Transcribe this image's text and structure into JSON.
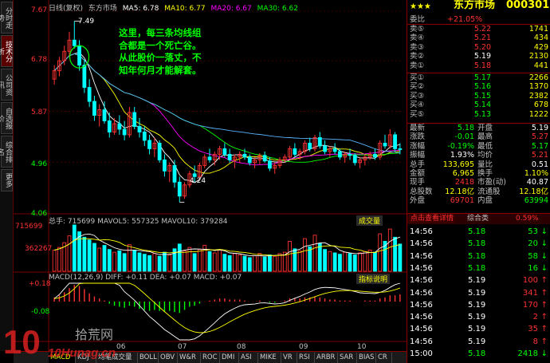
{
  "left_tabs": [
    "分时走势",
    "技术分析",
    "公司资讯",
    "自选报价",
    "综合排名",
    "更多"
  ],
  "header": {
    "period": "日线(复权)",
    "stock_name": "东方市场",
    "ma5": "MA5: 6.78",
    "ma10": "MA10: 6.77",
    "ma20": "MA20: 6.67",
    "ma30": "MA30: 6.62"
  },
  "price_axis": [
    "7.67",
    "6.78",
    "5.87",
    "4.96",
    "4.06"
  ],
  "annotations": {
    "high": "7.49",
    "low": "4.24",
    "comment_lines": [
      "这里，每三条均线组",
      "合都是一个死亡谷。",
      "从此股价一落丈，不",
      "知年何月才能解套。"
    ]
  },
  "volume": {
    "header": "总手: 715699 MAVOL5: 557325 MAVOL10: 379284",
    "axis": [
      "715699",
      "362267"
    ],
    "button": "成交量"
  },
  "macd": {
    "header": "MACD(12,26,9) DIFF: +0.11 DEA: +0.07 MACD: +0.07",
    "axis": [
      "+0.18",
      "-0.08"
    ],
    "button": "指标说明"
  },
  "month_labels": [
    "06",
    "07",
    "08",
    "09",
    "10"
  ],
  "bottom_tabs": [
    "MACD",
    "KDJ",
    "均笔成交量",
    "BOLL",
    "OBV",
    "W&R",
    "ROC",
    "DMI",
    "ASI",
    "MIKE",
    "VR",
    "RSI",
    "ARBR",
    "SAR",
    "BIAS",
    "CR"
  ],
  "chart_data": {
    "type": "candlestick",
    "title": "东方市场 日线(复权)",
    "ylim": [
      4.06,
      7.67
    ],
    "x_ticks": [
      "06",
      "07",
      "08",
      "09",
      "10"
    ],
    "candles": [
      [
        6.45,
        6.7,
        6.35,
        6.6
      ],
      [
        6.6,
        6.85,
        6.5,
        6.78
      ],
      [
        6.78,
        7.05,
        6.7,
        6.95
      ],
      [
        6.95,
        7.3,
        6.85,
        7.15
      ],
      [
        7.15,
        7.49,
        7.0,
        7.05
      ],
      [
        7.05,
        7.15,
        6.6,
        6.7
      ],
      [
        6.7,
        6.8,
        6.2,
        6.3
      ],
      [
        6.3,
        6.45,
        5.95,
        6.05
      ],
      [
        6.05,
        6.15,
        5.7,
        5.8
      ],
      [
        5.8,
        6.0,
        5.6,
        5.9
      ],
      [
        5.9,
        6.05,
        5.65,
        5.7
      ],
      [
        5.7,
        5.85,
        5.4,
        5.5
      ],
      [
        5.5,
        5.75,
        5.45,
        5.65
      ],
      [
        5.65,
        5.8,
        5.45,
        5.55
      ],
      [
        5.55,
        5.7,
        5.35,
        5.45
      ],
      [
        5.45,
        5.95,
        5.4,
        5.85
      ],
      [
        5.85,
        5.95,
        5.55,
        5.6
      ],
      [
        5.6,
        5.75,
        5.4,
        5.5
      ],
      [
        5.5,
        5.6,
        5.25,
        5.35
      ],
      [
        5.35,
        5.45,
        5.1,
        5.2
      ],
      [
        5.2,
        5.4,
        5.05,
        5.3
      ],
      [
        5.3,
        5.35,
        4.95,
        5.0
      ],
      [
        5.0,
        5.1,
        4.7,
        4.8
      ],
      [
        4.8,
        4.95,
        4.6,
        4.9
      ],
      [
        4.9,
        5.0,
        4.5,
        4.6
      ],
      [
        4.6,
        4.7,
        4.24,
        4.35
      ],
      [
        4.35,
        4.6,
        4.3,
        4.55
      ],
      [
        4.55,
        4.8,
        4.5,
        4.75
      ],
      [
        4.75,
        4.9,
        4.6,
        4.7
      ],
      [
        4.7,
        4.95,
        4.65,
        4.9
      ],
      [
        4.9,
        5.1,
        4.85,
        5.05
      ],
      [
        5.05,
        5.2,
        4.95,
        5.0
      ],
      [
        5.0,
        5.15,
        4.9,
        5.1
      ],
      [
        5.1,
        5.25,
        5.0,
        5.2
      ],
      [
        5.2,
        5.3,
        5.05,
        5.1
      ],
      [
        5.1,
        5.2,
        4.95,
        5.0
      ],
      [
        5.0,
        5.1,
        4.85,
        5.05
      ],
      [
        5.05,
        5.15,
        4.95,
        5.1
      ],
      [
        5.1,
        5.2,
        5.0,
        5.05
      ],
      [
        5.05,
        5.1,
        4.9,
        4.95
      ],
      [
        4.95,
        5.05,
        4.85,
        5.0
      ],
      [
        5.0,
        5.12,
        4.92,
        5.08
      ],
      [
        5.08,
        5.15,
        4.95,
        4.98
      ],
      [
        4.98,
        5.05,
        4.8,
        4.85
      ],
      [
        4.85,
        4.95,
        4.75,
        4.9
      ],
      [
        4.9,
        5.05,
        4.85,
        5.0
      ],
      [
        5.0,
        5.1,
        4.95,
        5.05
      ],
      [
        5.05,
        5.25,
        5.0,
        5.2
      ],
      [
        5.2,
        5.3,
        5.05,
        5.1
      ],
      [
        5.1,
        5.2,
        5.0,
        5.15
      ],
      [
        5.15,
        5.35,
        5.1,
        5.3
      ],
      [
        5.3,
        5.4,
        5.15,
        5.2
      ],
      [
        5.2,
        5.45,
        5.15,
        5.4
      ],
      [
        5.4,
        5.5,
        5.2,
        5.25
      ],
      [
        5.25,
        5.35,
        5.1,
        5.15
      ],
      [
        5.15,
        5.25,
        5.05,
        5.2
      ],
      [
        5.2,
        5.3,
        5.1,
        5.15
      ],
      [
        5.15,
        5.2,
        5.0,
        5.05
      ],
      [
        5.05,
        5.15,
        4.95,
        5.1
      ],
      [
        5.1,
        5.2,
        5.0,
        5.08
      ],
      [
        5.08,
        5.12,
        4.9,
        4.95
      ],
      [
        4.95,
        5.05,
        4.85,
        5.0
      ],
      [
        5.0,
        5.1,
        4.9,
        5.05
      ],
      [
        5.05,
        5.15,
        5.0,
        5.1
      ],
      [
        5.1,
        5.2,
        5.0,
        5.05
      ],
      [
        5.05,
        5.35,
        5.0,
        5.3
      ],
      [
        5.3,
        5.45,
        5.2,
        5.25
      ],
      [
        5.25,
        5.55,
        5.2,
        5.45
      ],
      [
        5.45,
        5.5,
        5.15,
        5.2
      ],
      [
        5.2,
        5.3,
        5.1,
        5.19
      ]
    ],
    "volumes": [
      3.1,
      3.5,
      4.2,
      5.2,
      6.8,
      5.8,
      5.0,
      4.6,
      4.1,
      3.4,
      3.8,
      3.2,
      2.8,
      3.0,
      2.6,
      3.9,
      3.1,
      2.7,
      2.5,
      2.3,
      2.6,
      2.2,
      2.8,
      2.4,
      3.3,
      4.0,
      3.0,
      3.5,
      2.6,
      3.2,
      3.8,
      2.9,
      2.7,
      3.1,
      2.5,
      2.3,
      2.6,
      2.4,
      2.2,
      2.0,
      2.3,
      2.6,
      2.1,
      2.4,
      2.2,
      2.6,
      2.8,
      4.4,
      3.3,
      3.0,
      4.8,
      3.6,
      5.3,
      4.1,
      3.2,
      2.9,
      2.7,
      2.5,
      2.8,
      2.6,
      2.4,
      2.7,
      2.9,
      3.1,
      2.8,
      5.5,
      4.4,
      6.2,
      5.0,
      4.0
    ],
    "macd_hist": [
      0.04,
      0.06,
      0.09,
      0.13,
      0.16,
      0.15,
      0.12,
      0.08,
      0.05,
      0.03,
      0.01,
      -0.02,
      -0.04,
      -0.05,
      -0.06,
      -0.04,
      -0.05,
      -0.07,
      -0.08,
      -0.09,
      -0.08,
      -0.09,
      -0.1,
      -0.09,
      -0.1,
      -0.11,
      -0.08,
      -0.05,
      -0.04,
      -0.02,
      0.0,
      0.01,
      0.02,
      0.03,
      0.03,
      0.02,
      0.02,
      0.02,
      0.01,
      0.0,
      0.0,
      0.01,
      0.0,
      -0.01,
      -0.01,
      0.0,
      0.01,
      0.03,
      0.03,
      0.03,
      0.04,
      0.04,
      0.05,
      0.04,
      0.03,
      0.02,
      0.02,
      0.01,
      0.01,
      0.01,
      0.0,
      0.0,
      0.01,
      0.01,
      0.01,
      0.03,
      0.04,
      0.06,
      0.06,
      0.07
    ]
  },
  "right_panel": {
    "title": "东方市场",
    "code": "000301",
    "stars": "★★★",
    "weibi_label": "委比",
    "weibi_value": "+21.05%",
    "asks": [
      {
        "label": "卖⑤",
        "price": "5.22",
        "vol": "1741"
      },
      {
        "label": "卖④",
        "price": "5.21",
        "vol": "434"
      },
      {
        "label": "卖③",
        "price": "5.20",
        "vol": "429"
      },
      {
        "label": "卖②",
        "price": "5.19",
        "vol": "2130"
      },
      {
        "label": "卖①",
        "price": "5.18",
        "vol": "441"
      }
    ],
    "bids": [
      {
        "label": "买①",
        "price": "5.17",
        "vol": "2266"
      },
      {
        "label": "买②",
        "price": "5.16",
        "vol": "1370"
      },
      {
        "label": "买③",
        "price": "5.15",
        "vol": "2382"
      },
      {
        "label": "买④",
        "price": "5.14",
        "vol": "678"
      },
      {
        "label": "买⑤",
        "price": "5.13",
        "vol": "1222"
      }
    ],
    "quote": [
      [
        "最新",
        "5.18",
        "开盘",
        "5.19"
      ],
      [
        "涨跌",
        "-0.01",
        "最高",
        "5.27"
      ],
      [
        "涨幅",
        "-0.19%",
        "最低",
        "5.17"
      ],
      [
        "振幅",
        "1.93%",
        "均价",
        "5.21"
      ],
      [
        "总手",
        "133,695",
        "量比",
        "0.51"
      ],
      [
        "金额",
        "6,965",
        "换手",
        "1.10%"
      ],
      [
        "现手",
        "2418",
        "市盈(动)",
        "40.87"
      ],
      [
        "总股数",
        "12.18亿",
        "流通股",
        "12.18亿"
      ],
      [
        "外盘",
        "69701",
        "内盘",
        "63994"
      ]
    ],
    "tabs": [
      "点击查看详情",
      "综合类"
    ],
    "tab_value": "0.59%",
    "ticks": [
      {
        "time": "14:56",
        "price": "5.18",
        "vol": "53",
        "dir": "down"
      },
      {
        "time": "14:56",
        "price": "5.18",
        "vol": "20",
        "dir": "down"
      },
      {
        "time": "14:56",
        "price": "5.18",
        "vol": "58",
        "dir": "down"
      },
      {
        "time": "14:56",
        "price": "5.18",
        "vol": "16",
        "dir": "down"
      },
      {
        "time": "14:56",
        "price": "5.19",
        "vol": "100",
        "dir": "up"
      },
      {
        "time": "14:56",
        "price": "5.19",
        "vol": "341",
        "dir": "up"
      },
      {
        "time": "14:56",
        "price": "5.19",
        "vol": "170",
        "dir": "up"
      },
      {
        "time": "14:56",
        "price": "5.19",
        "vol": "2",
        "dir": "up"
      },
      {
        "time": "14:56",
        "price": "5.19",
        "vol": "35",
        "dir": "up"
      },
      {
        "time": "14:56",
        "price": "5.19",
        "vol": "8",
        "dir": "up"
      },
      {
        "time": "15:00",
        "price": "5.18",
        "vol": "2418",
        "dir": "down"
      }
    ]
  },
  "watermark": {
    "big": "10",
    "cn": "拾荒网",
    "url": "10Hunag.cn"
  },
  "colors": {
    "up": "#ff3232",
    "down": "#00ffff",
    "ma5": "#ffffff",
    "ma10": "#ffff00",
    "ma20": "#ff00ff",
    "ma30": "#00ff00",
    "ma60": "#5ab4ff",
    "grid": "#7a0000",
    "accent": "#ffff00"
  }
}
